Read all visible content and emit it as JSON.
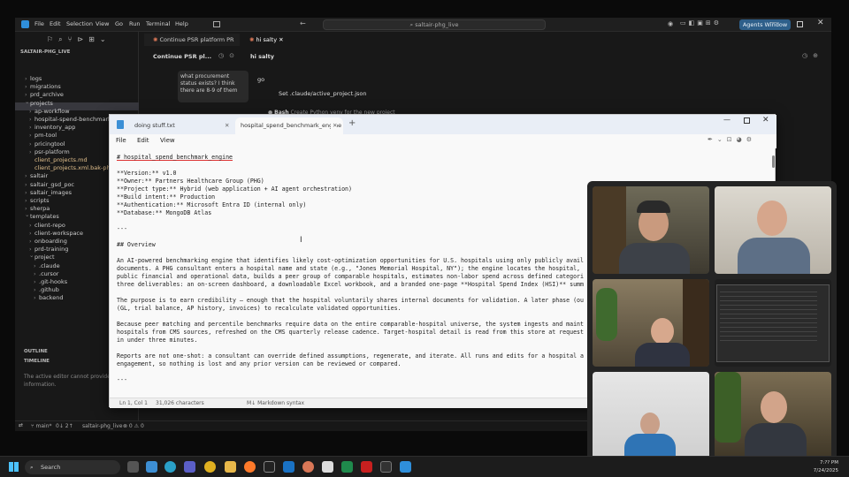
{
  "vscode": {
    "menu": [
      "File",
      "Edit",
      "Selection",
      "View",
      "Go",
      "Run",
      "Terminal",
      "Help"
    ],
    "command_center": "saltair-phg_live",
    "agents_button": "Agents Window",
    "sidebar_title": "SALTAIR-PHG_LIVE",
    "tree": [
      "logs",
      "migrations",
      "prd_archive",
      "projects",
      "ap-workflow",
      "hospital-spend-benchmark-engine",
      "inventory_app",
      "pm-tool",
      "pricingtool",
      "psr-platform",
      "client_projects.md",
      "client_projects.xml.bak-phase",
      "saltair",
      "saltair_gsd_poc",
      "saltair_images",
      "scripts",
      "sherpa",
      "templates",
      "client-repo",
      "client-workspace",
      "onboarding",
      "prd-training",
      "project",
      ".claude",
      ".cursor",
      ".git-hooks",
      ".github",
      "backend"
    ],
    "outline": "OUTLINE",
    "timeline": "TIMELINE",
    "timeline_note": "The active editor cannot provide information.",
    "tab1": "Continue PSR platform PR",
    "tab2": "hi salty",
    "pane1_title": "Continue PSR pl...",
    "pane2_title": "hi salty",
    "chat_bubble": "what procurement status exists? I think there are 8-9 of them",
    "chat_go": "go",
    "chat_step": "Set .claude/active_project.json",
    "chat_bash_label": "Bash",
    "chat_bash": "Create Python venv for the new project",
    "status_branch": "main*",
    "status_sync": "0↓ 2↑",
    "status_folder": "saltair-phg_live",
    "status_problems": "⊗ 0 ⚠ 0"
  },
  "notepad": {
    "tab1": "doing stuff.txt",
    "tab2": "hospital_spend_benchmark_engine",
    "menu": [
      "File",
      "Edit",
      "View"
    ],
    "lines": [
      "# hospital_spend_benchmark_engine",
      "",
      "**Version:** v1.0",
      "**Owner:** Partners Healthcare Group (PHG)",
      "**Project type:** Hybrid (web application + AI agent orchestration)",
      "**Build intent:** Production",
      "**Authentication:** Microsoft Entra ID (internal only)",
      "**Database:** MongoDB Atlas",
      "",
      "---",
      "",
      "## Overview",
      "",
      "An AI-powered benchmarking engine that identifies likely cost-optimization opportunities for U.S. hospitals using only publicly avail",
      "documents. A PHG consultant enters a hospital name and state (e.g., \"Jones Memorial Hospital, NY\"); the engine locates the hospital,",
      "public financial and operational data, builds a peer group of comparable hospitals, estimates non-labor spend across defined categori",
      "three deliverables: an on-screen dashboard, a downloadable Excel workbook, and a branded one-page **Hospital Spend Index (HSI)** summ",
      "",
      "The purpose is to earn credibility — enough that the hospital voluntarily shares internal documents for validation. A later phase (ou",
      "(GL, trial balance, AP history, invoices) to recalculate validated opportunities.",
      "",
      "Because peer matching and percentile benchmarks require data on the entire comparable-hospital universe, the system ingests and maint",
      "hospitals from CMS sources, refreshed on the CMS quarterly release cadence. Target-hospital detail is read from this store at request",
      "in under three minutes.",
      "",
      "Reports are not one-shot: a consultant can override defined assumptions, regenerate, and iterate. All runs and edits for a hospital a",
      "engagement, so nothing is lost and any prior version can be reviewed or compared.",
      "",
      "---"
    ],
    "status_pos": "Ln 1, Col 1",
    "status_chars": "31,026 characters",
    "status_syntax": "Markdown syntax"
  },
  "taskbar": {
    "search_placeholder": "Search",
    "time": "7:?? PM",
    "date": "7/24/2025"
  }
}
